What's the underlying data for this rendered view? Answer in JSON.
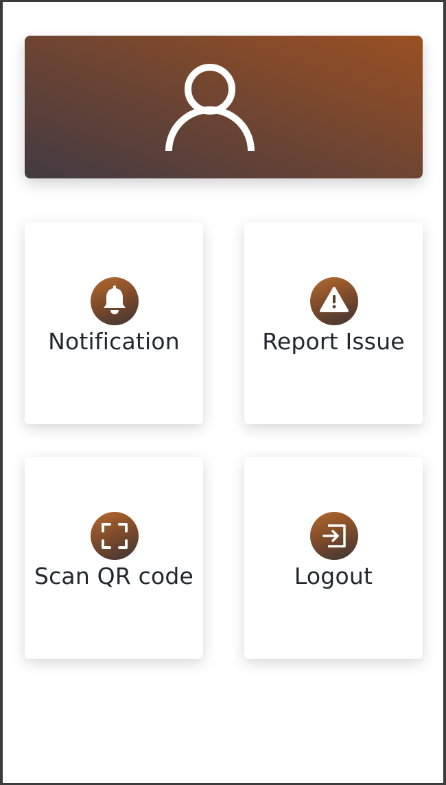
{
  "header": {
    "avatar_icon": "user-icon",
    "gradient_start": "#433a42",
    "gradient_end": "#9a5022"
  },
  "menu": {
    "items": [
      {
        "label": "Notification",
        "icon": "bell-icon"
      },
      {
        "label": "Report Issue",
        "icon": "warning-icon"
      },
      {
        "label": "Scan QR code",
        "icon": "scan-icon"
      },
      {
        "label": "Logout",
        "icon": "logout-icon"
      }
    ]
  },
  "colors": {
    "icon_gradient_start": "#b56a2f",
    "icon_gradient_end": "#3e3434",
    "label_text": "#23262e"
  }
}
